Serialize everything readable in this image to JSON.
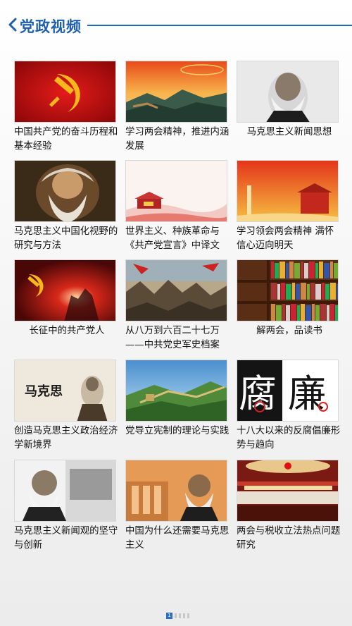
{
  "header": {
    "title": "党政视频",
    "back_icon": "chevron-left-icon",
    "accent": "#1e6bc3"
  },
  "videos": [
    {
      "caption": "中国共产党的奋斗历程和基本经验"
    },
    {
      "caption": "学习两会精神，推进内涵发展"
    },
    {
      "caption": "马克思主义新闻思想"
    },
    {
      "caption": "马克思主义中国化视野的研究与方法"
    },
    {
      "caption": "世界主义、种族革命与《共产党宣言》中译文"
    },
    {
      "caption": "学习领会两会精神 满怀信心迈向明天"
    },
    {
      "caption": "长征中的共产党人"
    },
    {
      "caption": "从八万到六百二十七万——中共党史军史档案"
    },
    {
      "caption": "解两会，品读书"
    },
    {
      "caption": "创造马克思主义政治经济学新境界"
    },
    {
      "caption": "党导立宪制的理论与实践"
    },
    {
      "caption": "十八大以来的反腐倡廉形势与趋向"
    },
    {
      "caption": "马克思主义新闻观的坚守与创新"
    },
    {
      "caption": "中国为什么还需要马克思主义"
    },
    {
      "caption": "两会与税收立法热点问题研究"
    }
  ],
  "thumb_text": {
    "marx_calligraphy": "马克思",
    "fu": "腐",
    "lian": "廉"
  },
  "pager": {
    "current": "1"
  }
}
